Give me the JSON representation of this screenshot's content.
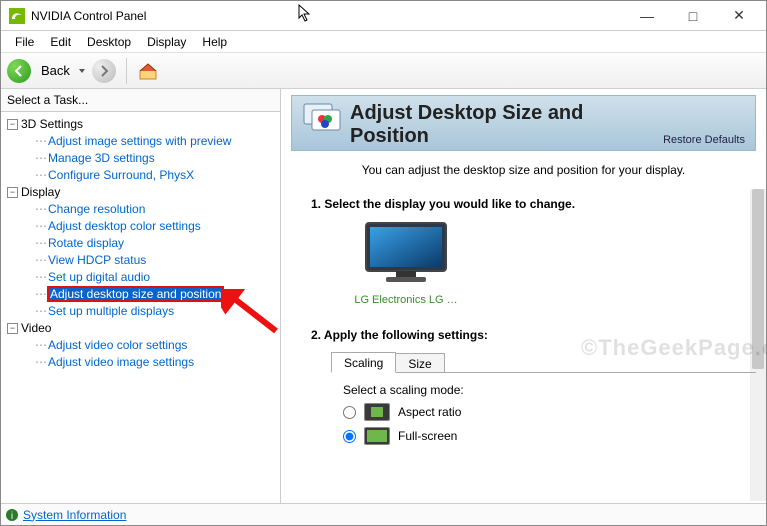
{
  "window": {
    "title": "NVIDIA Control Panel"
  },
  "menu": {
    "file": "File",
    "edit": "Edit",
    "desktop": "Desktop",
    "display": "Display",
    "help": "Help"
  },
  "toolbar": {
    "back": "Back"
  },
  "sidebar": {
    "header": "Select a Task...",
    "cat_3d": "3D Settings",
    "cat_display": "Display",
    "cat_video": "Video",
    "items_3d": {
      "a": "Adjust image settings with preview",
      "b": "Manage 3D settings",
      "c": "Configure Surround, PhysX"
    },
    "items_display": {
      "a": "Change resolution",
      "b": "Adjust desktop color settings",
      "c": "Rotate display",
      "d": "View HDCP status",
      "e": "Set up digital audio",
      "f": "Adjust desktop size and position",
      "g": "Set up multiple displays"
    },
    "items_video": {
      "a": "Adjust video color settings",
      "b": "Adjust video image settings"
    }
  },
  "page": {
    "title": "Adjust Desktop Size and Position",
    "restore": "Restore Defaults",
    "desc": "You can adjust the desktop size and position for your display.",
    "step1": "1. Select the display you would like to change.",
    "display_name": "LG Electronics LG …",
    "step2": "2. Apply the following settings:",
    "tab_scaling": "Scaling",
    "tab_size": "Size",
    "scaling_label": "Select a scaling mode:",
    "mode_aspect": "Aspect ratio",
    "mode_fullscreen": "Full-screen",
    "selected_mode": "fullscreen"
  },
  "status": {
    "sysinfo": "System Information"
  },
  "watermark": "©TheGeekPage.com"
}
